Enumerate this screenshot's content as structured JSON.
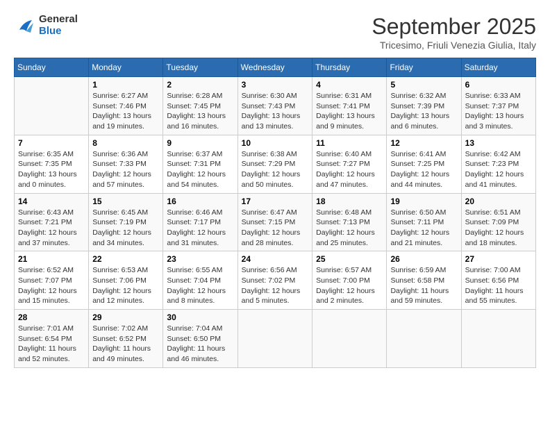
{
  "header": {
    "logo_line1": "General",
    "logo_line2": "Blue",
    "title": "September 2025",
    "location": "Tricesimo, Friuli Venezia Giulia, Italy"
  },
  "days_of_week": [
    "Sunday",
    "Monday",
    "Tuesday",
    "Wednesday",
    "Thursday",
    "Friday",
    "Saturday"
  ],
  "weeks": [
    [
      {
        "day": "",
        "info": ""
      },
      {
        "day": "1",
        "info": "Sunrise: 6:27 AM\nSunset: 7:46 PM\nDaylight: 13 hours\nand 19 minutes."
      },
      {
        "day": "2",
        "info": "Sunrise: 6:28 AM\nSunset: 7:45 PM\nDaylight: 13 hours\nand 16 minutes."
      },
      {
        "day": "3",
        "info": "Sunrise: 6:30 AM\nSunset: 7:43 PM\nDaylight: 13 hours\nand 13 minutes."
      },
      {
        "day": "4",
        "info": "Sunrise: 6:31 AM\nSunset: 7:41 PM\nDaylight: 13 hours\nand 9 minutes."
      },
      {
        "day": "5",
        "info": "Sunrise: 6:32 AM\nSunset: 7:39 PM\nDaylight: 13 hours\nand 6 minutes."
      },
      {
        "day": "6",
        "info": "Sunrise: 6:33 AM\nSunset: 7:37 PM\nDaylight: 13 hours\nand 3 minutes."
      }
    ],
    [
      {
        "day": "7",
        "info": "Sunrise: 6:35 AM\nSunset: 7:35 PM\nDaylight: 13 hours\nand 0 minutes."
      },
      {
        "day": "8",
        "info": "Sunrise: 6:36 AM\nSunset: 7:33 PM\nDaylight: 12 hours\nand 57 minutes."
      },
      {
        "day": "9",
        "info": "Sunrise: 6:37 AM\nSunset: 7:31 PM\nDaylight: 12 hours\nand 54 minutes."
      },
      {
        "day": "10",
        "info": "Sunrise: 6:38 AM\nSunset: 7:29 PM\nDaylight: 12 hours\nand 50 minutes."
      },
      {
        "day": "11",
        "info": "Sunrise: 6:40 AM\nSunset: 7:27 PM\nDaylight: 12 hours\nand 47 minutes."
      },
      {
        "day": "12",
        "info": "Sunrise: 6:41 AM\nSunset: 7:25 PM\nDaylight: 12 hours\nand 44 minutes."
      },
      {
        "day": "13",
        "info": "Sunrise: 6:42 AM\nSunset: 7:23 PM\nDaylight: 12 hours\nand 41 minutes."
      }
    ],
    [
      {
        "day": "14",
        "info": "Sunrise: 6:43 AM\nSunset: 7:21 PM\nDaylight: 12 hours\nand 37 minutes."
      },
      {
        "day": "15",
        "info": "Sunrise: 6:45 AM\nSunset: 7:19 PM\nDaylight: 12 hours\nand 34 minutes."
      },
      {
        "day": "16",
        "info": "Sunrise: 6:46 AM\nSunset: 7:17 PM\nDaylight: 12 hours\nand 31 minutes."
      },
      {
        "day": "17",
        "info": "Sunrise: 6:47 AM\nSunset: 7:15 PM\nDaylight: 12 hours\nand 28 minutes."
      },
      {
        "day": "18",
        "info": "Sunrise: 6:48 AM\nSunset: 7:13 PM\nDaylight: 12 hours\nand 25 minutes."
      },
      {
        "day": "19",
        "info": "Sunrise: 6:50 AM\nSunset: 7:11 PM\nDaylight: 12 hours\nand 21 minutes."
      },
      {
        "day": "20",
        "info": "Sunrise: 6:51 AM\nSunset: 7:09 PM\nDaylight: 12 hours\nand 18 minutes."
      }
    ],
    [
      {
        "day": "21",
        "info": "Sunrise: 6:52 AM\nSunset: 7:07 PM\nDaylight: 12 hours\nand 15 minutes."
      },
      {
        "day": "22",
        "info": "Sunrise: 6:53 AM\nSunset: 7:06 PM\nDaylight: 12 hours\nand 12 minutes."
      },
      {
        "day": "23",
        "info": "Sunrise: 6:55 AM\nSunset: 7:04 PM\nDaylight: 12 hours\nand 8 minutes."
      },
      {
        "day": "24",
        "info": "Sunrise: 6:56 AM\nSunset: 7:02 PM\nDaylight: 12 hours\nand 5 minutes."
      },
      {
        "day": "25",
        "info": "Sunrise: 6:57 AM\nSunset: 7:00 PM\nDaylight: 12 hours\nand 2 minutes."
      },
      {
        "day": "26",
        "info": "Sunrise: 6:59 AM\nSunset: 6:58 PM\nDaylight: 11 hours\nand 59 minutes."
      },
      {
        "day": "27",
        "info": "Sunrise: 7:00 AM\nSunset: 6:56 PM\nDaylight: 11 hours\nand 55 minutes."
      }
    ],
    [
      {
        "day": "28",
        "info": "Sunrise: 7:01 AM\nSunset: 6:54 PM\nDaylight: 11 hours\nand 52 minutes."
      },
      {
        "day": "29",
        "info": "Sunrise: 7:02 AM\nSunset: 6:52 PM\nDaylight: 11 hours\nand 49 minutes."
      },
      {
        "day": "30",
        "info": "Sunrise: 7:04 AM\nSunset: 6:50 PM\nDaylight: 11 hours\nand 46 minutes."
      },
      {
        "day": "",
        "info": ""
      },
      {
        "day": "",
        "info": ""
      },
      {
        "day": "",
        "info": ""
      },
      {
        "day": "",
        "info": ""
      }
    ]
  ]
}
